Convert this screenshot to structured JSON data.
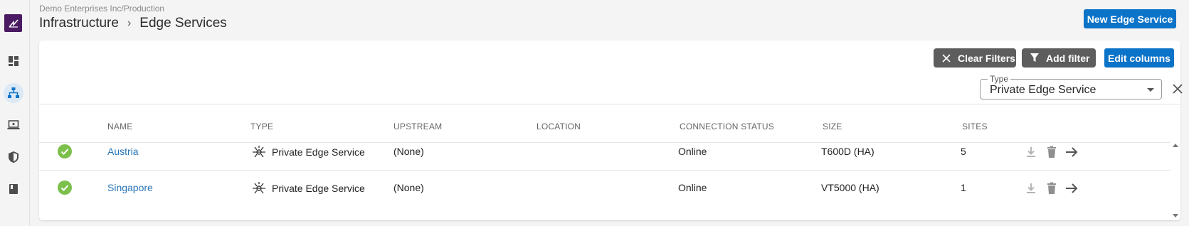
{
  "sidebar": {
    "items": [
      {
        "icon": "dashboard-icon"
      },
      {
        "icon": "network-hierarchy-icon",
        "active": true
      },
      {
        "icon": "laptop-icon"
      },
      {
        "icon": "shield-icon"
      },
      {
        "icon": "book-icon"
      }
    ]
  },
  "header": {
    "org_path": "Demo Enterprises Inc/Production",
    "breadcrumb": [
      "Infrastructure",
      "Edge Services"
    ],
    "separator": "›",
    "new_button": "New Edge Service"
  },
  "toolbar": {
    "clear_filters": "Clear Filters",
    "add_filter": "Add filter",
    "edit_columns": "Edit columns"
  },
  "filter": {
    "label": "Type",
    "value": "Private Edge Service"
  },
  "table": {
    "columns": [
      "NAME",
      "TYPE",
      "UPSTREAM",
      "LOCATION",
      "CONNECTION STATUS",
      "SIZE",
      "SITES"
    ],
    "rows": [
      {
        "name": "Austria",
        "type": "Private Edge Service",
        "upstream": "(None)",
        "location": "",
        "connection_status": "Online",
        "size": "T600D (HA)",
        "sites": "5"
      },
      {
        "name": "Singapore",
        "type": "Private Edge Service",
        "upstream": "(None)",
        "location": "",
        "connection_status": "Online",
        "size": "VT5000 (HA)",
        "sites": "1"
      }
    ]
  },
  "colors": {
    "primary": "#0b73c8",
    "dark_button": "#5d5d5d",
    "link": "#2a76b8",
    "status_ok": "#7cc04b",
    "brand": "#4a1a63"
  }
}
